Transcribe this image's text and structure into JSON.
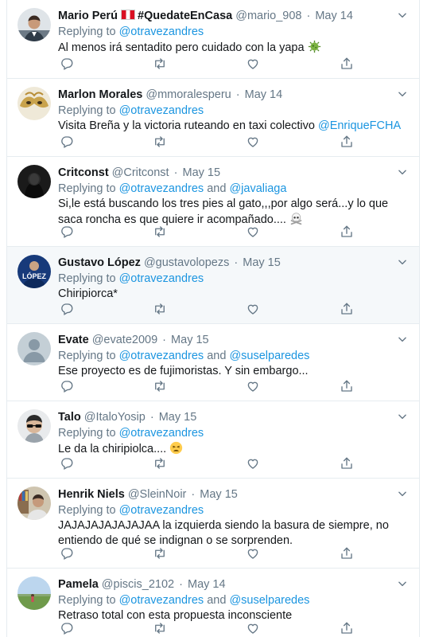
{
  "replying_to_label": "Replying to",
  "and_label": "and",
  "tweets": [
    {
      "name": "Mario Perú",
      "hashtag": "#QuedateEnCasa",
      "handle": "@mario_908",
      "date": "May 14",
      "replying": [
        "@otravezandres"
      ],
      "text": "Al menos irá sentadito pero cuidado con la yapa",
      "emoji": "virus",
      "avatar": "man-suit",
      "flag": true
    },
    {
      "name": "Marlon Morales",
      "handle": "@mmoralesperu",
      "date": "May 14",
      "replying": [
        "@otravezandres"
      ],
      "text": "Visita Breña y la victoria ruteando en taxi colectivo",
      "mention": "@EnriqueFCHA",
      "avatar": "mask"
    },
    {
      "name": "Critconst",
      "handle": "@Critconst",
      "date": "May 15",
      "replying": [
        "@otravezandres",
        "@javaliaga"
      ],
      "text": "Si,le está buscando los tres pies al gato,,,por algo será...y lo que saca roncha es que quiere ir acompañado....",
      "emoji": "skull",
      "avatar": "dark"
    },
    {
      "name": "Gustavo López",
      "handle": "@gustavolopezs",
      "date": "May 15",
      "replying": [
        "@otravezandres"
      ],
      "text": "Chiripiorca*",
      "avatar": "lopez",
      "avatar_text": "LÓPEZ",
      "highlight": true
    },
    {
      "name": "Evate",
      "handle": "@evate2009",
      "date": "May 15",
      "replying": [
        "@otravezandres",
        "@suselparedes"
      ],
      "text": "Ese proyecto es de fujimoristas. Y sin embargo...",
      "avatar": "default"
    },
    {
      "name": "Talo",
      "handle": "@ItaloYosip",
      "date": "May 15",
      "replying": [
        "@otravezandres"
      ],
      "text": "Le da la chiripiolca....",
      "emoji": "tired-face",
      "avatar": "sunglasses"
    },
    {
      "name": "Henrik Niels",
      "handle": "@SleinNoir",
      "date": "May 15",
      "replying": [
        "@otravezandres"
      ],
      "text": "JAJAJAJAJAJAJAA la izquierda siendo la basura de siempre, no entiendo de qué se indignan o se sorprenden.",
      "avatar": "bookshelf"
    },
    {
      "name": "Pamela",
      "handle": "@piscis_2102",
      "date": "May 14",
      "replying": [
        "@otravezandres",
        "@suselparedes"
      ],
      "text": "Retraso total con esta propuesta inconsciente",
      "avatar": "field"
    }
  ]
}
